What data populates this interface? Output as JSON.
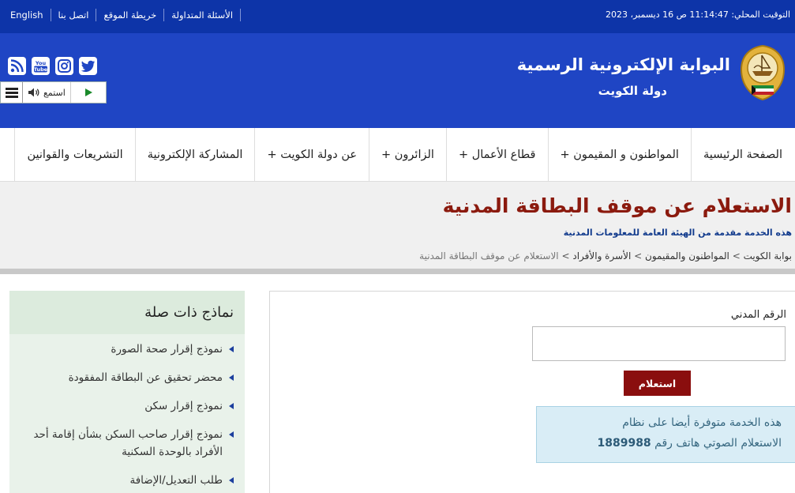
{
  "topbar": {
    "local_time": "التوقيت المحلي: 11:14:47 ص 16 ديسمبر، 2023",
    "links": [
      "English",
      "اتصل بنا",
      "خريطة الموقع",
      "الأسئلة المتداولة"
    ]
  },
  "header": {
    "title": "البوابة الإلكترونية الرسمية",
    "subtitle": "دولة  الكويت",
    "listen_label": "استمع",
    "social_icons": [
      "rss-icon",
      "youtube-icon",
      "instagram-icon",
      "twitter-icon"
    ]
  },
  "nav": {
    "items": [
      "الصفحة الرئيسية",
      "المواطنون و المقيمون +",
      "قطاع الأعمال +",
      "الزائرون +",
      "عن دولة الكويت +",
      "المشاركة الإلكترونية",
      "التشريعات والقوانين"
    ]
  },
  "page": {
    "title": "الاستعلام عن موقف البطاقة المدنية",
    "description": "هذه الخدمة مقدمة من الهيئة العامة للمعلومات المدنية",
    "breadcrumb": [
      "بوابة الكويت",
      "المواطنون والمقيمون",
      "الأسرة والأفراد",
      "الاستعلام عن موقف البطاقة المدنية"
    ],
    "breadcrumb_sep": ">"
  },
  "form": {
    "civil_id_label": "الرقم المدني",
    "civil_id_value": "",
    "submit_label": "استعلام",
    "notice_line1": "هذه الخدمة متوفرة أيضا على نظام",
    "notice_line2_prefix": "الاستعلام الصوتي هاتف رقم",
    "notice_phone": "1889988"
  },
  "related": {
    "title": "نماذج ذات صلة",
    "items": [
      "نموذج إقرار صحة الصورة",
      "محضر تحقيق عن البطاقة المفقودة",
      "نموذج إقرار سكن",
      "نموذج إقرار صاحب السكن بشأن إقامة أحد الأفراد بالوحدة السكنية",
      "طلب التعديل/الإضافة"
    ]
  },
  "colors": {
    "topbar": "#0d34a8",
    "header": "#1f45c4",
    "title_red": "#8b1a0e",
    "button": "#8a0e0e",
    "notice_bg": "#d9edf6",
    "sidebar_bg": "#e9f2ea"
  }
}
